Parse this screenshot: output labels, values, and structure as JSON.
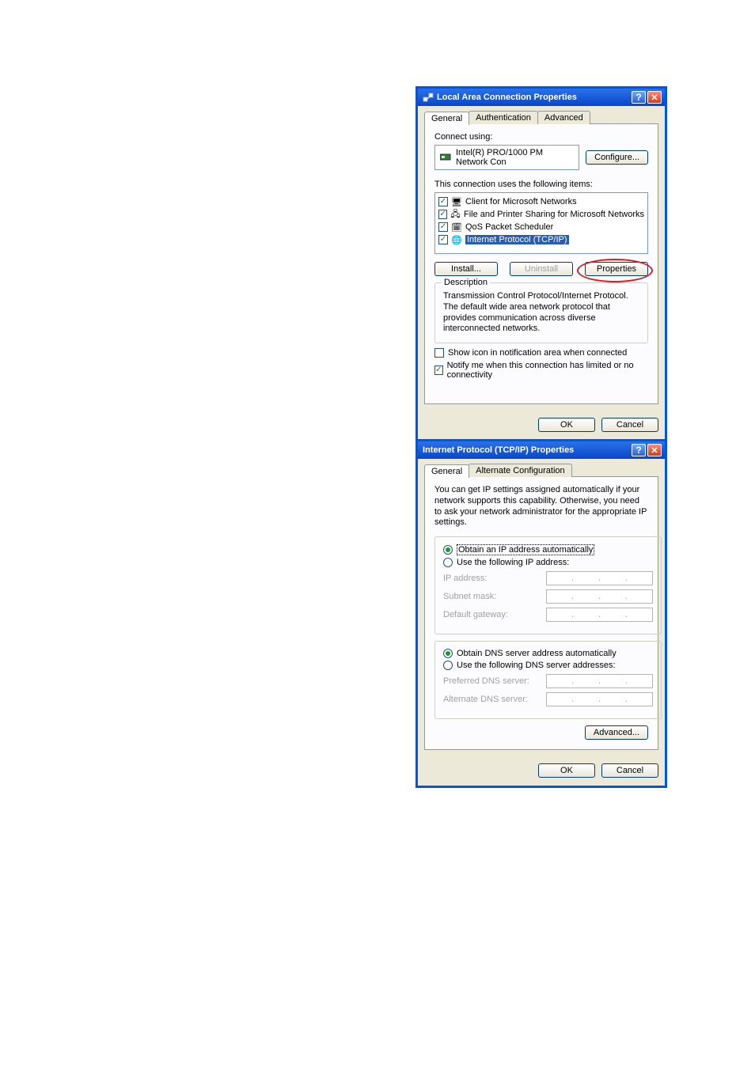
{
  "dialog1": {
    "title": "Local Area Connection Properties",
    "tabs": [
      "General",
      "Authentication",
      "Advanced"
    ],
    "connect_using_label": "Connect using:",
    "adapter": "Intel(R) PRO/1000 PM Network Con",
    "configure_btn": "Configure...",
    "uses_label": "This connection uses the following items:",
    "items": [
      {
        "checked": true,
        "text": "Client for Microsoft Networks"
      },
      {
        "checked": true,
        "text": "File and Printer Sharing for Microsoft Networks"
      },
      {
        "checked": true,
        "text": "QoS Packet Scheduler"
      },
      {
        "checked": true,
        "text": "Internet Protocol (TCP/IP)",
        "selected": true
      }
    ],
    "install_btn": "Install...",
    "uninstall_btn": "Uninstall",
    "properties_btn": "Properties",
    "desc_header": "Description",
    "desc_text": "Transmission Control Protocol/Internet Protocol. The default wide area network protocol that provides communication across diverse interconnected networks.",
    "show_icon_check": {
      "checked": false,
      "label": "Show icon in notification area when connected"
    },
    "notify_check": {
      "checked": true,
      "label": "Notify me when this connection has limited or no connectivity"
    },
    "ok_btn": "OK",
    "cancel_btn": "Cancel"
  },
  "dialog2": {
    "title": "Internet Protocol (TCP/IP) Properties",
    "tabs": [
      "General",
      "Alternate Configuration"
    ],
    "intro": "You can get IP settings assigned automatically if your network supports this capability. Otherwise, you need to ask your network administrator for the appropriate IP settings.",
    "radio_obtain_ip": "Obtain an IP address automatically",
    "radio_use_ip": "Use the following IP address:",
    "ip_address_lbl": "IP address:",
    "subnet_lbl": "Subnet mask:",
    "gateway_lbl": "Default gateway:",
    "radio_obtain_dns": "Obtain DNS server address automatically",
    "radio_use_dns": "Use the following DNS server addresses:",
    "pref_dns_lbl": "Preferred DNS server:",
    "alt_dns_lbl": "Alternate DNS server:",
    "advanced_btn": "Advanced...",
    "ok_btn": "OK",
    "cancel_btn": "Cancel"
  }
}
